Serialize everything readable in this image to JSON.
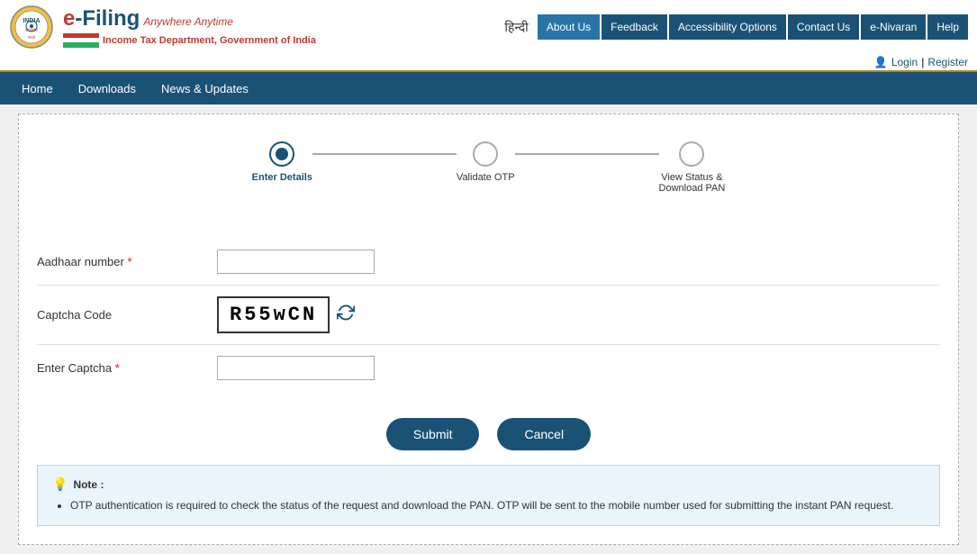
{
  "header": {
    "logo_alt": "Income Tax Department Emblem",
    "efiling_label": "e-Filing",
    "efiling_tagline": "Anywhere Anytime",
    "dept_label": "Income Tax Department, Government of India",
    "hindi_label": "हिन्दी",
    "nav_links": [
      {
        "label": "About Us",
        "id": "about-us"
      },
      {
        "label": "Feedback",
        "id": "feedback"
      },
      {
        "label": "Accessibility Options",
        "id": "accessibility-options"
      },
      {
        "label": "Contact Us",
        "id": "contact-us"
      },
      {
        "label": "e-Nivaran",
        "id": "e-nivaran"
      },
      {
        "label": "Help",
        "id": "help"
      }
    ],
    "login_label": "Login",
    "register_label": "Register",
    "separator": "|"
  },
  "main_nav": {
    "items": [
      {
        "label": "Home",
        "id": "home"
      },
      {
        "label": "Downloads",
        "id": "downloads"
      },
      {
        "label": "News & Updates",
        "id": "news-updates"
      }
    ]
  },
  "stepper": {
    "steps": [
      {
        "label": "Enter Details",
        "state": "active"
      },
      {
        "label": "Validate OTP",
        "state": "inactive"
      },
      {
        "label": "View Status & Download PAN",
        "state": "inactive"
      }
    ]
  },
  "form": {
    "aadhaar_label": "Aadhaar number",
    "aadhaar_required": true,
    "captcha_code_label": "Captcha Code",
    "captcha_value": "R55wCN",
    "enter_captcha_label": "Enter Captcha",
    "enter_captcha_required": true,
    "submit_label": "Submit",
    "cancel_label": "Cancel"
  },
  "note": {
    "title": "Note :",
    "icon": "💡",
    "text": "OTP authentication is required to check the status of the request and download the PAN. OTP will be sent to the mobile number used for submitting the instant PAN request."
  }
}
